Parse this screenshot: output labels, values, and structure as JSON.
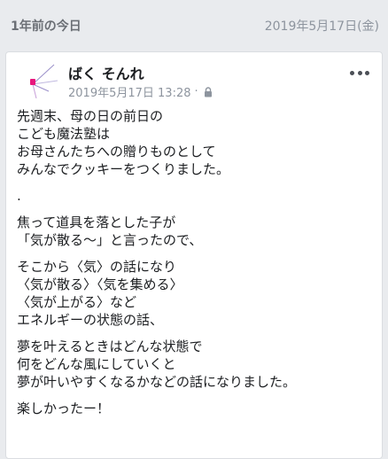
{
  "memories": {
    "label": "1年前の今日",
    "date": "2019年5月17日(金)"
  },
  "post": {
    "author": "ばく そんれ",
    "timestamp": "2019年5月17日 13:28",
    "separator": "·",
    "privacy_icon": "lock-icon",
    "paragraphs": [
      [
        "先週末、母の日の前日の",
        "こども魔法塾は",
        "お母さんたちへの贈りものとして",
        "みんなでクッキーをつくりました。"
      ],
      [
        "."
      ],
      [
        "焦って道具を落とした子が",
        "「気が散る～」と言ったので、"
      ],
      [
        "そこから〈気〉の話になり",
        "〈気が散る〉〈気を集める〉",
        "〈気が上がる〉など",
        "エネルギーの状態の話、"
      ],
      [
        "夢を叶えるときはどんな状態で",
        "何をどんな風にしていくと",
        "夢が叶いやすくなるかなどの話になりました。"
      ],
      [
        "楽しかったー！"
      ]
    ]
  },
  "colors": {
    "background": "#e9ebee",
    "card": "#ffffff",
    "muted_text": "#8d949e",
    "avatar_accent": "#e8177d"
  }
}
